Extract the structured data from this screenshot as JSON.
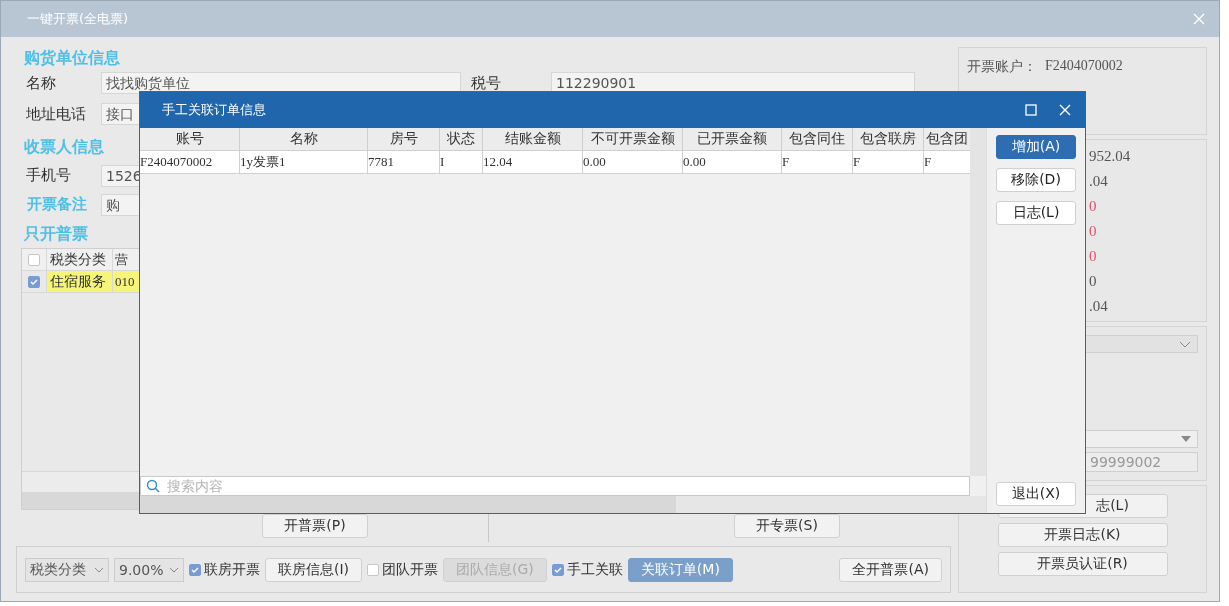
{
  "window": {
    "title": "一键开票(全电票)"
  },
  "buyer": {
    "heading": "购货单位信息",
    "name_label": "名称",
    "name_value": "找找购货单位",
    "tax_label": "税号",
    "tax_value": "112290901",
    "addr_label": "地址电话",
    "addr_value": "接口"
  },
  "receiver": {
    "heading": "收票人信息",
    "phone_label": "手机号",
    "phone_value": "1526",
    "remark_label": "开票备注",
    "remark_value": "购"
  },
  "grid": {
    "heading": "只开普票",
    "header_checked": false,
    "columns": [
      "税类分类",
      "营"
    ],
    "rows": [
      {
        "checked": true,
        "cells": [
          "住宿服务",
          "010"
        ]
      }
    ]
  },
  "account": {
    "label": "开票账户：",
    "value": "F2404070002"
  },
  "amounts": [
    {
      "text": "952.04",
      "color": "#555555"
    },
    {
      "text": ".04",
      "color": "#555555"
    },
    {
      "text": "0",
      "color": "#e0506a"
    },
    {
      "text": "0",
      "color": "#e0506a"
    },
    {
      "text": "0",
      "color": "#e0506a"
    },
    {
      "text": "0",
      "color": "#555555"
    },
    {
      "text": ".04",
      "color": "#555555"
    }
  ],
  "right_field": "99999002",
  "right_buttons": [
    "志(L)",
    "开票日志(K)",
    "开票员认证(R)"
  ],
  "issue_buttons": [
    "开普票(P)",
    "开专票(S)"
  ],
  "toolbar": [
    {
      "kind": "select",
      "text": "税类分类"
    },
    {
      "kind": "select",
      "text": "9.00%"
    },
    {
      "kind": "checkbox",
      "text": "联房开票",
      "checked": true
    },
    {
      "kind": "button",
      "text": "联房信息(I)",
      "disabled": false,
      "primary": false
    },
    {
      "kind": "checkbox",
      "text": "团队开票",
      "checked": false
    },
    {
      "kind": "button",
      "text": "团队信息(G)",
      "disabled": true,
      "primary": false
    },
    {
      "kind": "checkbox",
      "text": "手工关联",
      "checked": true
    },
    {
      "kind": "button",
      "text": "关联订单(M)",
      "disabled": false,
      "primary": true
    },
    {
      "kind": "button",
      "text": "全开普票(A)",
      "disabled": false,
      "primary": false
    }
  ],
  "dialog": {
    "title": "手工关联订单信息",
    "columns": [
      "账号",
      "名称",
      "房号",
      "状态",
      "结账金额",
      "不可开票金额",
      "已开票金额",
      "包含同住",
      "包含联房",
      "包含团"
    ],
    "rows": [
      [
        "F2404070002",
        "1y发票1",
        "7781",
        "I",
        "12.04",
        "0.00",
        "0.00",
        "F",
        "F",
        "F"
      ]
    ],
    "buttons": [
      {
        "text": "增加(A)",
        "primary": true
      },
      {
        "text": "移除(D)",
        "primary": false
      },
      {
        "text": "日志(L)",
        "primary": false
      }
    ],
    "exit_button": "退出(X)",
    "search": {
      "placeholder": "搜索内容"
    }
  }
}
